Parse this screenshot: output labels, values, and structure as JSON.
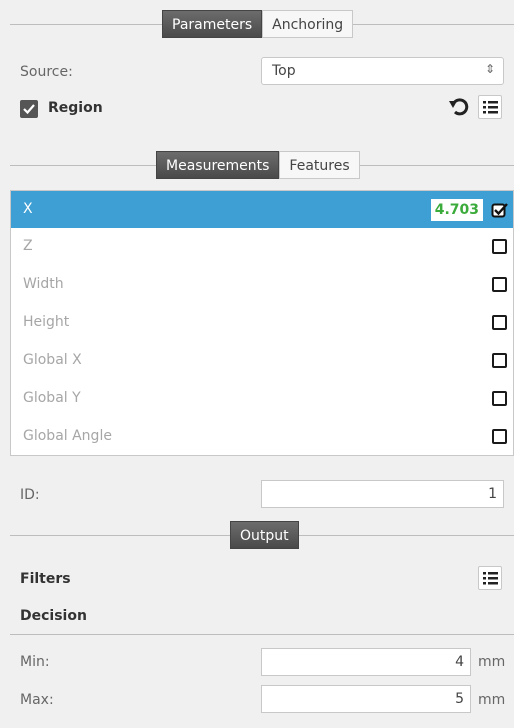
{
  "tabs_top": {
    "parameters": "Parameters",
    "anchoring": "Anchoring"
  },
  "source": {
    "label": "Source:",
    "value": "Top"
  },
  "region": {
    "label": "Region"
  },
  "tabs_mid": {
    "measurements": "Measurements",
    "features": "Features"
  },
  "measurements": [
    {
      "label": "X",
      "value": "4.703",
      "checked": true,
      "selected": true
    },
    {
      "label": "Z",
      "checked": false
    },
    {
      "label": "Width",
      "checked": false
    },
    {
      "label": "Height",
      "checked": false
    },
    {
      "label": "Global X",
      "checked": false
    },
    {
      "label": "Global Y",
      "checked": false
    },
    {
      "label": "Global Angle",
      "checked": false
    }
  ],
  "id_field": {
    "label": "ID:",
    "value": "1"
  },
  "output": {
    "tab": "Output",
    "filters_label": "Filters",
    "decision_label": "Decision",
    "min": {
      "label": "Min:",
      "value": "4",
      "unit": "mm"
    },
    "max": {
      "label": "Max:",
      "value": "5",
      "unit": "mm"
    }
  }
}
